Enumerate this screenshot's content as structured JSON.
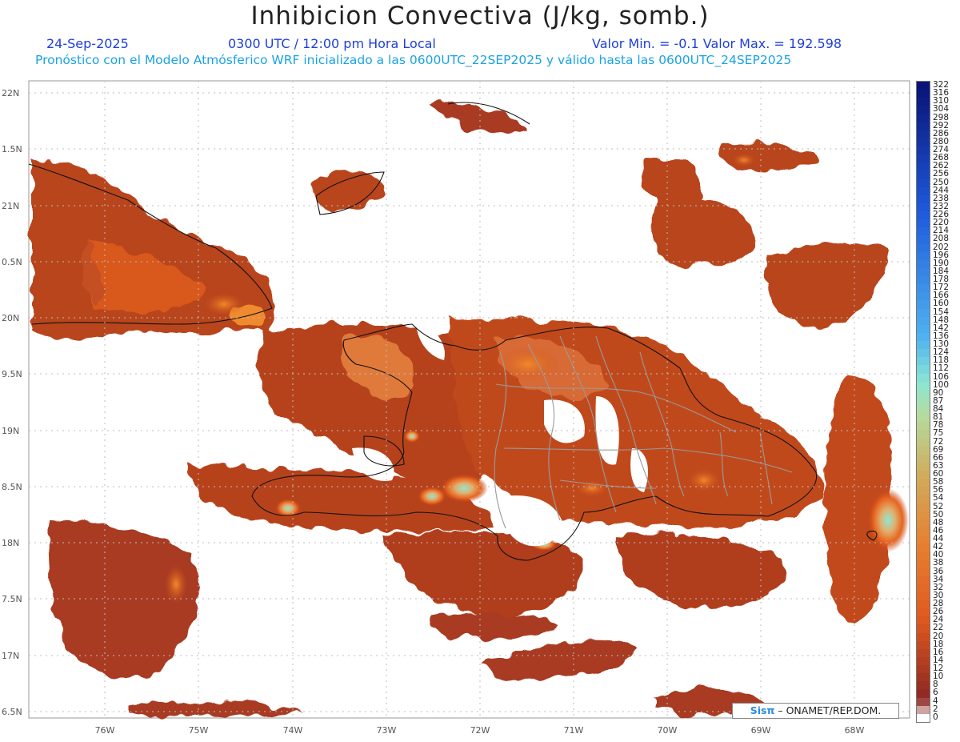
{
  "header": {
    "title": "Inhibicion Convectiva (J/kg, somb.)",
    "date": "24-Sep-2025",
    "time": "0300 UTC / 12:00 pm Hora Local",
    "minmax": "Valor Min. = -0.1  Valor Max. = 192.598",
    "subtitle": "Pronóstico con el Modelo Atmósferico WRF inicializado a las 0600UTC_22SEP2025 y válido hasta las  0600UTC_24SEP2025"
  },
  "lat_labels": [
    "22N",
    "1.5N",
    "21N",
    "0.5N",
    "20N",
    "9.5N",
    "19N",
    "8.5N",
    "18N",
    "7.5N",
    "17N",
    "6.5N"
  ],
  "lon_labels": [
    "76W",
    "75W",
    "74W",
    "73W",
    "72W",
    "71W",
    "70W",
    "69W",
    "68W"
  ],
  "colorbar": {
    "labels": [
      "322",
      "316",
      "310",
      "304",
      "298",
      "292",
      "286",
      "280",
      "274",
      "268",
      "262",
      "256",
      "250",
      "244",
      "238",
      "232",
      "226",
      "220",
      "214",
      "208",
      "202",
      "196",
      "190",
      "184",
      "178",
      "172",
      "166",
      "160",
      "154",
      "148",
      "142",
      "136",
      "130",
      "124",
      "118",
      "112",
      "106",
      "100",
      "90",
      "87",
      "84",
      "81",
      "78",
      "75",
      "72",
      "69",
      "66",
      "63",
      "60",
      "58",
      "56",
      "54",
      "52",
      "50",
      "48",
      "46",
      "44",
      "42",
      "40",
      "38",
      "36",
      "34",
      "32",
      "30",
      "28",
      "26",
      "24",
      "22",
      "20",
      "18",
      "16",
      "14",
      "12",
      "10",
      "8",
      "6",
      "4",
      "2",
      "0"
    ]
  },
  "credit": {
    "brand": "Sisπ",
    "text": " – ONAMET/REP.DOM."
  }
}
